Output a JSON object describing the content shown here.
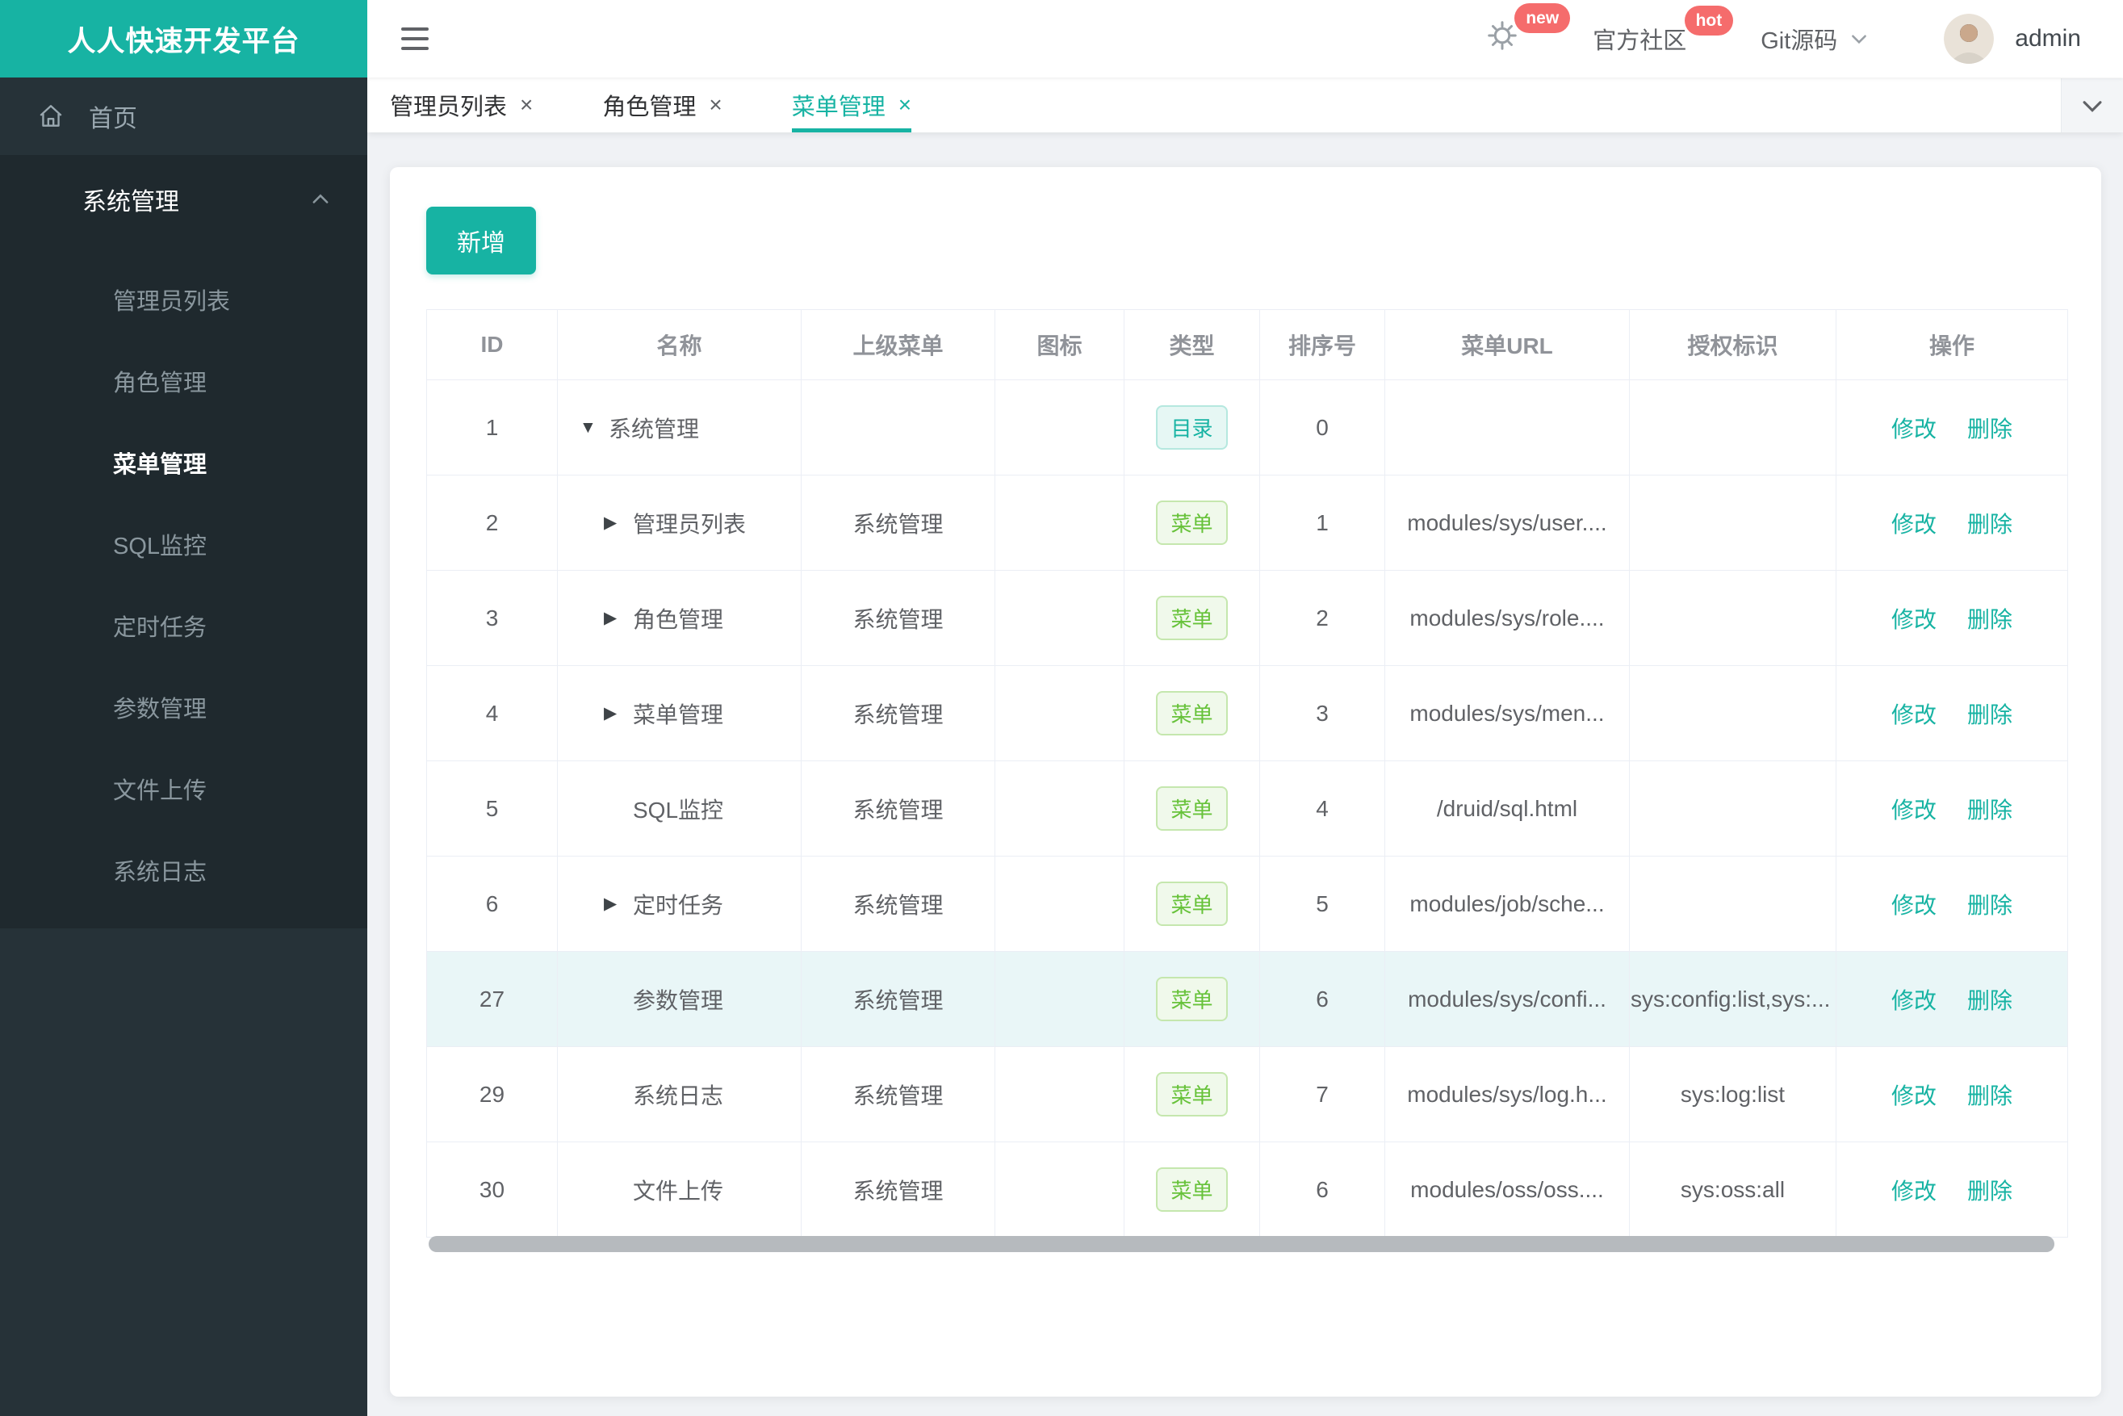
{
  "colors": {
    "accent": "#17b3a3",
    "tag_menu_green": "#67c23a",
    "badge_red": "#f56c6c",
    "sidebar_bg": "#263238",
    "sidebar_submenu_bg": "#1f292e",
    "page_bg": "#f0f2f5"
  },
  "brand": {
    "title": "人人快速开发平台"
  },
  "header": {
    "gear_badge": "new",
    "community_label": "官方社区",
    "community_badge": "hot",
    "git_label": "Git源码",
    "user_name": "admin"
  },
  "sidebar": {
    "home_label": "首页",
    "section": {
      "title": "系统管理",
      "items": [
        {
          "label": "管理员列表",
          "active": false
        },
        {
          "label": "角色管理",
          "active": false
        },
        {
          "label": "菜单管理",
          "active": true
        },
        {
          "label": "SQL监控",
          "active": false
        },
        {
          "label": "定时任务",
          "active": false
        },
        {
          "label": "参数管理",
          "active": false
        },
        {
          "label": "文件上传",
          "active": false
        },
        {
          "label": "系统日志",
          "active": false
        }
      ]
    }
  },
  "tabs": [
    {
      "label": "管理员列表",
      "active": false
    },
    {
      "label": "角色管理",
      "active": false
    },
    {
      "label": "菜单管理",
      "active": true
    }
  ],
  "toolbar": {
    "add_label": "新增"
  },
  "table": {
    "columns": [
      "ID",
      "名称",
      "上级菜单",
      "图标",
      "类型",
      "排序号",
      "菜单URL",
      "授权标识",
      "操作"
    ],
    "type_labels": {
      "catalog": "目录",
      "menu": "菜单"
    },
    "actions": {
      "edit": "修改",
      "delete": "删除"
    },
    "rows": [
      {
        "id": "1",
        "name": "系统管理",
        "arrow": "down",
        "level": 0,
        "parent": "",
        "type": "catalog",
        "order": "0",
        "url": "",
        "perm": ""
      },
      {
        "id": "2",
        "name": "管理员列表",
        "arrow": "right",
        "level": 1,
        "parent": "系统管理",
        "type": "menu",
        "order": "1",
        "url": "modules/sys/user....",
        "perm": ""
      },
      {
        "id": "3",
        "name": "角色管理",
        "arrow": "right",
        "level": 1,
        "parent": "系统管理",
        "type": "menu",
        "order": "2",
        "url": "modules/sys/role....",
        "perm": ""
      },
      {
        "id": "4",
        "name": "菜单管理",
        "arrow": "right",
        "level": 1,
        "parent": "系统管理",
        "type": "menu",
        "order": "3",
        "url": "modules/sys/men...",
        "perm": ""
      },
      {
        "id": "5",
        "name": "SQL监控",
        "arrow": "none",
        "level": 1,
        "parent": "系统管理",
        "type": "menu",
        "order": "4",
        "url": "/druid/sql.html",
        "perm": ""
      },
      {
        "id": "6",
        "name": "定时任务",
        "arrow": "right",
        "level": 1,
        "parent": "系统管理",
        "type": "menu",
        "order": "5",
        "url": "modules/job/sche...",
        "perm": ""
      },
      {
        "id": "27",
        "name": "参数管理",
        "arrow": "none",
        "level": 1,
        "parent": "系统管理",
        "type": "menu",
        "order": "6",
        "url": "modules/sys/confi...",
        "perm": "sys:config:list,sys:...",
        "perm_overflow": true,
        "highlight": true
      },
      {
        "id": "29",
        "name": "系统日志",
        "arrow": "none",
        "level": 1,
        "parent": "系统管理",
        "type": "menu",
        "order": "7",
        "url": "modules/sys/log.h...",
        "perm": "sys:log:list"
      },
      {
        "id": "30",
        "name": "文件上传",
        "arrow": "none",
        "level": 1,
        "parent": "系统管理",
        "type": "menu",
        "order": "6",
        "url": "modules/oss/oss....",
        "perm": "sys:oss:all"
      }
    ]
  }
}
